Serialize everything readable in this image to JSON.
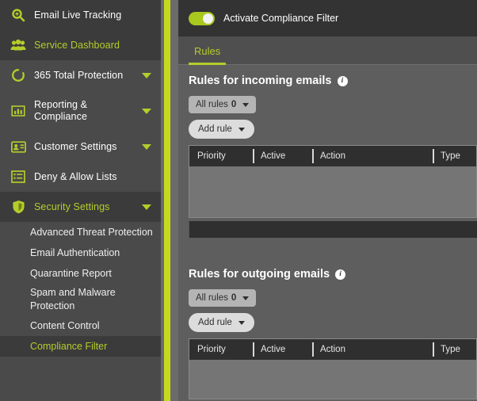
{
  "colors": {
    "accent": "#b5cc2a",
    "divider_bar": "#c7d91c",
    "sidebar_bg": "#4a4a4a",
    "sidebar_active_bg": "#3b3b3b",
    "main_bg": "#5e5e5e",
    "topbar_bg": "#333333",
    "table_header_bg": "#2f2f2f",
    "toggle_on": "#a8c81e"
  },
  "sidebar": {
    "items": [
      {
        "label": "Email Live Tracking",
        "icon": "search-magnifier-icon",
        "state": "hover",
        "caret": false
      },
      {
        "label": "Service Dashboard",
        "icon": "users-group-icon",
        "state": "active",
        "caret": false
      },
      {
        "label": "365 Total Protection",
        "icon": "circle-arrow-icon",
        "state": "normal",
        "caret": true
      },
      {
        "label": "Reporting & Compliance",
        "icon": "bar-chart-icon",
        "state": "normal",
        "caret": true
      },
      {
        "label": "Customer Settings",
        "icon": "id-card-icon",
        "state": "normal",
        "caret": true
      },
      {
        "label": "Deny & Allow Lists",
        "icon": "list-icon",
        "state": "normal",
        "caret": false
      },
      {
        "label": "Security Settings",
        "icon": "shield-icon",
        "state": "active",
        "caret": true
      }
    ],
    "subitems": [
      {
        "label": "Advanced Threat Protection",
        "selected": false
      },
      {
        "label": "Email Authentication",
        "selected": false
      },
      {
        "label": "Quarantine Report",
        "selected": false
      },
      {
        "label": "Spam and Malware Protection",
        "selected": false
      },
      {
        "label": "Content Control",
        "selected": false
      },
      {
        "label": "Compliance Filter",
        "selected": true
      }
    ]
  },
  "main": {
    "toggle": {
      "label": "Activate Compliance Filter",
      "state": "on"
    },
    "tabs": [
      {
        "label": "Rules",
        "active": true
      }
    ],
    "sections": [
      {
        "title": "Rules for incoming emails",
        "info": "i",
        "filter_button": {
          "label": "All rules",
          "count": "0"
        },
        "add_button": {
          "label": "Add rule"
        },
        "table": {
          "columns": [
            "Priority",
            "Active",
            "Action",
            "Type"
          ],
          "rows": []
        }
      },
      {
        "title": "Rules for outgoing emails",
        "info": "i",
        "filter_button": {
          "label": "All rules",
          "count": "0"
        },
        "add_button": {
          "label": "Add rule"
        },
        "table": {
          "columns": [
            "Priority",
            "Active",
            "Action",
            "Type"
          ],
          "rows": []
        }
      }
    ]
  }
}
